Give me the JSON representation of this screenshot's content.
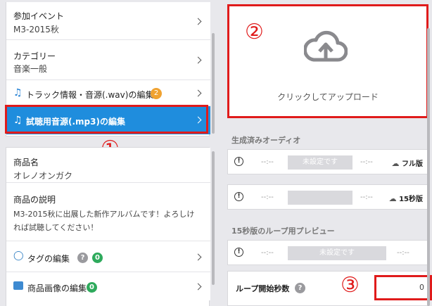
{
  "left": {
    "event": {
      "title": "参加イベント",
      "value": "M3-2015秋"
    },
    "category": {
      "title": "カテゴリー",
      "value": "音楽一般"
    },
    "track_info": {
      "label": "トラック情報・音源(.wav)の編集",
      "badge": "2"
    },
    "trial_audio": {
      "label": "試聴用音源(.mp3)の編集"
    },
    "product_name": {
      "title": "商品名",
      "value": "オレノオンガク"
    },
    "product_desc": {
      "title": "商品の説明",
      "line1": "M3-2015秋に出展した新作アルバムです！よろしけ",
      "line2": "れば試聴してください！"
    },
    "tags": {
      "label": "タグの編集",
      "help": "?",
      "count": "0"
    },
    "images": {
      "label": "商品画像の編集",
      "count": "0"
    }
  },
  "right": {
    "upload": {
      "label": "クリックしてアップロード"
    },
    "generated": {
      "heading": "生成済みオーディオ",
      "full": {
        "time_start": "--:--",
        "status": "未設定です",
        "time_end": "--:--",
        "download_label": "フル版"
      },
      "short": {
        "time_start": "--:--",
        "status": "",
        "time_end": "--:--",
        "download_label": "15秒版"
      }
    },
    "loop_preview": {
      "heading": "15秒版のループ用プレビュー",
      "row": {
        "time_start": "--:--",
        "status": "未設定です",
        "time_end": "--:--"
      }
    },
    "loop_start": {
      "label": "ループ開始秒数",
      "help": "?",
      "value": "0"
    }
  },
  "annotations": {
    "one": "①",
    "two": "②",
    "three": "③"
  },
  "colors": {
    "accent": "#1f8ddd",
    "highlight": "#e01b1b",
    "badge_orange": "#f0a231",
    "badge_green": "#2eaa5c"
  }
}
